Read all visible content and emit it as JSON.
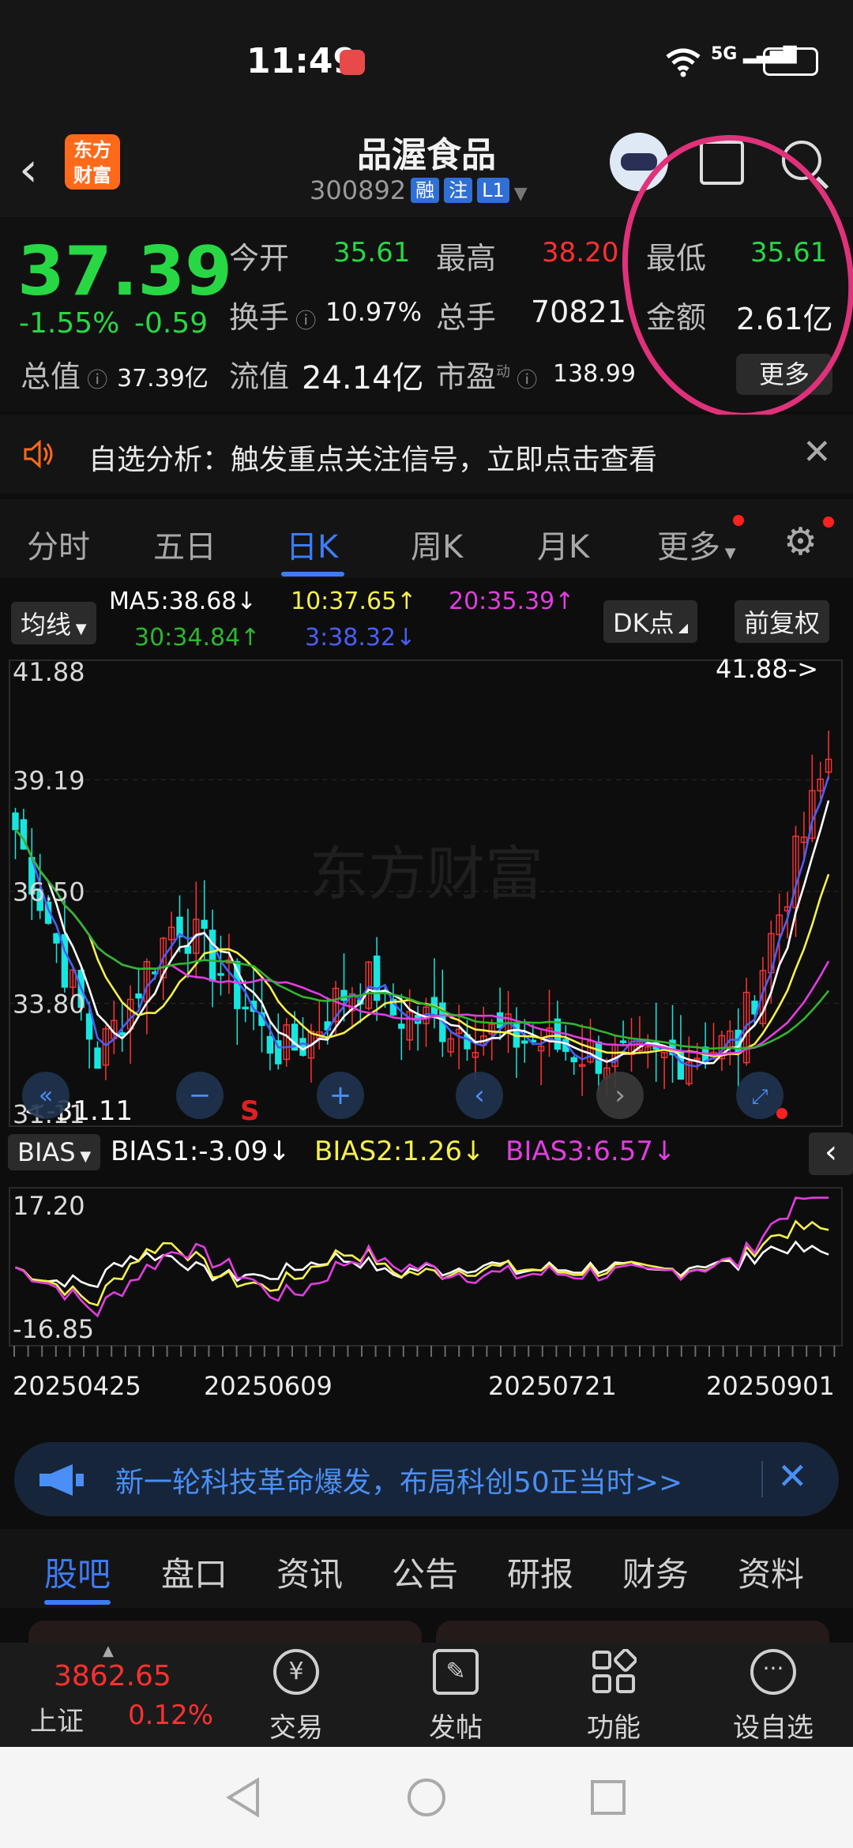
{
  "status_bar": {
    "time": "11:49",
    "network": "5G"
  },
  "header": {
    "app_logo": "东方财富",
    "stock_name": "品渥食品",
    "stock_code": "300892",
    "tags": [
      "融",
      "注",
      "L1"
    ]
  },
  "quote": {
    "price": "37.39",
    "change_pct": "-1.55%",
    "change_amt": "-0.59",
    "fields": [
      {
        "label": "今开",
        "value": "35.61",
        "color": "green"
      },
      {
        "label": "最高",
        "value": "38.20",
        "color": "red"
      },
      {
        "label": "最低",
        "value": "35.61",
        "color": "green"
      },
      {
        "label": "换手",
        "value": "10.97%",
        "color": "white"
      },
      {
        "label": "总手",
        "value": "70821",
        "color": "white"
      },
      {
        "label": "金额",
        "value": "2.61亿",
        "color": "white"
      },
      {
        "label": "总值",
        "value": "37.39亿",
        "color": "white"
      },
      {
        "label": "流值",
        "value": "24.14亿",
        "color": "white"
      },
      {
        "label": "市盈",
        "value": "138.99",
        "color": "white"
      }
    ],
    "pe_superscript": "动",
    "more_button": "更多"
  },
  "notice": {
    "text": "自选分析：触发重点关注信号，立即点击查看"
  },
  "k_tabs": [
    "分时",
    "五日",
    "日K",
    "周K",
    "月K",
    "更多"
  ],
  "k_tabs_active": 2,
  "chart_head": {
    "ma_button": "均线",
    "ma5": "MA5:38.68↓",
    "ma10": "10:37.65↑",
    "ma20": "20:35.39↑",
    "ma30": "30:34.84↑",
    "ma3": "3:38.32↓",
    "dk_button": "DK点",
    "adjust_button": "前复权",
    "colors": {
      "ma5": "#ffffff",
      "ma10": "#f5f04a",
      "ma20": "#e23de0",
      "ma30": "#2fb52f",
      "ma3": "#4a5ef5"
    }
  },
  "chart_data": [
    {
      "type": "candlestick",
      "title": "",
      "yticks": [
        "41.88",
        "39.19",
        "36.50",
        "33.80",
        "31.11"
      ],
      "ylim": [
        31.11,
        41.88
      ],
      "max_annotation": "41.88->",
      "min_annotation": "<-31.11",
      "signal_marker": "S",
      "series": [
        {
          "name": "MA5",
          "color": "#ffffff"
        },
        {
          "name": "MA10",
          "color": "#f5f04a"
        },
        {
          "name": "MA20",
          "color": "#e23de0"
        },
        {
          "name": "MA30",
          "color": "#2fb52f"
        }
      ]
    },
    {
      "type": "line",
      "title": "",
      "yticks": [
        "17.20",
        "-16.85"
      ],
      "ylim": [
        -16.85,
        17.2
      ],
      "series": [
        {
          "name": "BIAS1",
          "label": "BIAS1:-3.09↓",
          "color": "#ffffff"
        },
        {
          "name": "BIAS2",
          "label": "BIAS2:1.26↓",
          "color": "#f5f04a"
        },
        {
          "name": "BIAS3",
          "label": "BIAS3:6.57↓",
          "color": "#e23de0"
        }
      ],
      "x_ticks": [
        "20250425",
        "20250609",
        "20250721",
        "20250901"
      ]
    }
  ],
  "bias_head": {
    "button": "BIAS"
  },
  "banner": {
    "text": "新一轮科技革命爆发，布局科创50正当时>>"
  },
  "section_tabs": [
    "股吧",
    "盘口",
    "资讯",
    "公告",
    "研报",
    "财务",
    "资料"
  ],
  "section_tabs_active": 0,
  "bottom_nav": {
    "index_value": "3862.65",
    "index_name": "上证",
    "index_change": "0.12%",
    "items": [
      "交易",
      "发帖",
      "功能",
      "设自选"
    ]
  }
}
